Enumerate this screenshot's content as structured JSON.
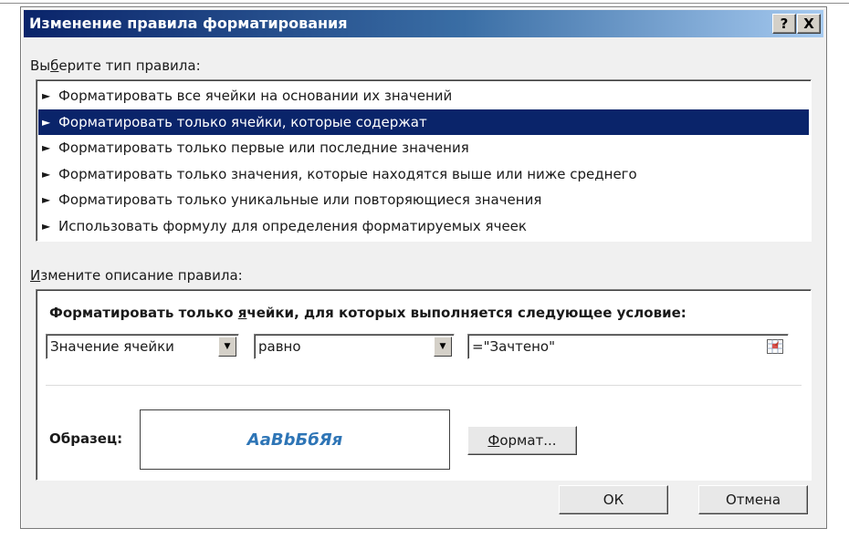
{
  "dialog": {
    "title": "Изменение правила форматирования",
    "help_label": "?",
    "close_label": "X"
  },
  "rule_type": {
    "label_prefix": "Вы",
    "label_accel": "б",
    "label_suffix": "ерите тип правила:",
    "items": [
      {
        "text": "Форматировать все ячейки на основании их значений",
        "selected": false
      },
      {
        "text": "Форматировать только ячейки, которые содержат",
        "selected": true
      },
      {
        "text": "Форматировать только первые или последние значения",
        "selected": false
      },
      {
        "text": "Форматировать только значения, которые находятся выше или ниже среднего",
        "selected": false
      },
      {
        "text": "Форматировать только уникальные или повторяющиеся значения",
        "selected": false
      },
      {
        "text": "Использовать формулу для определения форматируемых ячеек",
        "selected": false
      }
    ],
    "bullet": "►"
  },
  "description": {
    "label_accel": "И",
    "label_suffix": "змените описание правила:",
    "condition_title_prefix": "Форматировать только ",
    "condition_title_accel": "я",
    "condition_title_suffix": "чейки, для которых выполняется следующее условие:",
    "field_select": "Значение ячейки",
    "operator_select": "равно",
    "value_input": "=\"Зачтено\"",
    "sample_label": "Образец:",
    "sample_text": "АаBbБбЯя",
    "sample_color": "#2e75b6",
    "format_button_accel": "Ф",
    "format_button_suffix": "ормат..."
  },
  "footer": {
    "ok_label": "ОК",
    "cancel_label": "Отмена"
  },
  "colors": {
    "selection": "#0a246a",
    "titlebar_start": "#0a246a",
    "titlebar_end": "#a6caf0"
  }
}
